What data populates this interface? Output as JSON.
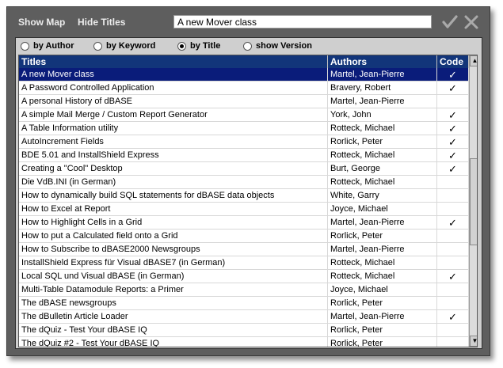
{
  "toolbar": {
    "show_map": "Show Map",
    "hide_titles": "Hide Titles",
    "search_value": "A new Mover class"
  },
  "search_modes": [
    "by Author",
    "by Keyword",
    "by Title",
    "show Version"
  ],
  "selected_mode": "by Title",
  "grid": {
    "headers": [
      "Titles",
      "Authors",
      "Code"
    ],
    "rows": [
      [
        "A new Mover class",
        "Martel, Jean-Pierre",
        "✓"
      ],
      [
        "A Password Controlled Application",
        "Bravery, Robert",
        "✓"
      ],
      [
        "A personal History of dBASE",
        "Martel, Jean-Pierre",
        ""
      ],
      [
        "A simple Mail Merge / Custom Report Generator",
        "York, John",
        "✓"
      ],
      [
        "A Table Information utility",
        "Rotteck, Michael",
        "✓"
      ],
      [
        "AutoIncrement Fields",
        "Rorlick, Peter",
        "✓"
      ],
      [
        "BDE 5.01 and InstallShield Express",
        "Rotteck, Michael",
        "✓"
      ],
      [
        "Creating a \"Cool\" Desktop",
        "Burt, George",
        "✓"
      ],
      [
        "Die VdB.INI  (in German)",
        "Rotteck, Michael",
        ""
      ],
      [
        "How to dynamically build SQL statements for dBASE data objects",
        "White, Garry",
        ""
      ],
      [
        "How to Excel at Report",
        "Joyce, Michael",
        ""
      ],
      [
        "How to Highlight Cells in a Grid",
        "Martel, Jean-Pierre",
        "✓"
      ],
      [
        "How to put a Calculated field onto a Grid",
        "Rorlick, Peter",
        ""
      ],
      [
        "How to Subscribe to dBASE2000 Newsgroups",
        "Martel, Jean-Pierre",
        ""
      ],
      [
        "InstallShield Express für Visual dBASE7  (in German)",
        "Rotteck, Michael",
        ""
      ],
      [
        "Local SQL und Visual dBASE  (in German)",
        "Rotteck, Michael",
        "✓"
      ],
      [
        "Multi-Table Datamodule Reports: a Primer",
        "Joyce, Michael",
        ""
      ],
      [
        "The dBASE newsgroups",
        "Rorlick, Peter",
        ""
      ],
      [
        "The dBulletin Article Loader",
        "Martel, Jean-Pierre",
        "✓"
      ],
      [
        "The dQuiz - Test Your dBASE IQ",
        "Rorlick, Peter",
        ""
      ],
      [
        "The dQuiz #2 - Test Your dBASE IQ",
        "Rorlick, Peter",
        ""
      ]
    ]
  },
  "colors": {
    "header": "#12357a",
    "selection": "#0a1c7a",
    "frame": "#5e5e5e"
  },
  "icons": {
    "ok": "checkmark-icon",
    "cancel": "close-icon"
  }
}
